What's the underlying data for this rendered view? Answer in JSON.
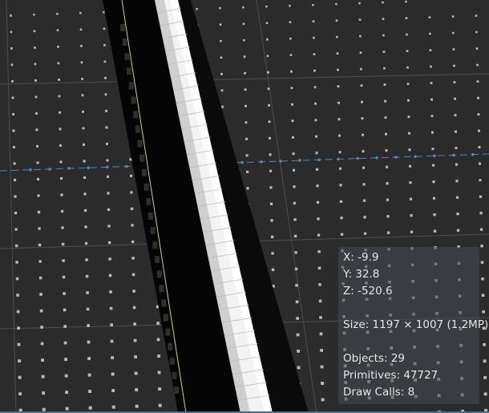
{
  "viewport": {
    "stats": {
      "x_label": "X: -9.9",
      "y_label": "Y: 32.8",
      "z_label": "Z: -520.6",
      "size_label": "Size: 1197 × 1007 (1.2MP)",
      "objects_label": "Objects: 29",
      "primitives_label": "Primitives: 47727",
      "draw_calls_label": "Draw Calls: 8"
    }
  },
  "colors": {
    "background": "#2b2b2b",
    "grid_dot": "#b8b8b8",
    "grid_line": "#555555",
    "axis_line": "#3d8fd1",
    "shadow": "#000000",
    "rail": "#f2f2f2",
    "selection_line": "#d8d84a",
    "panel_text": "#e6e6e6"
  }
}
